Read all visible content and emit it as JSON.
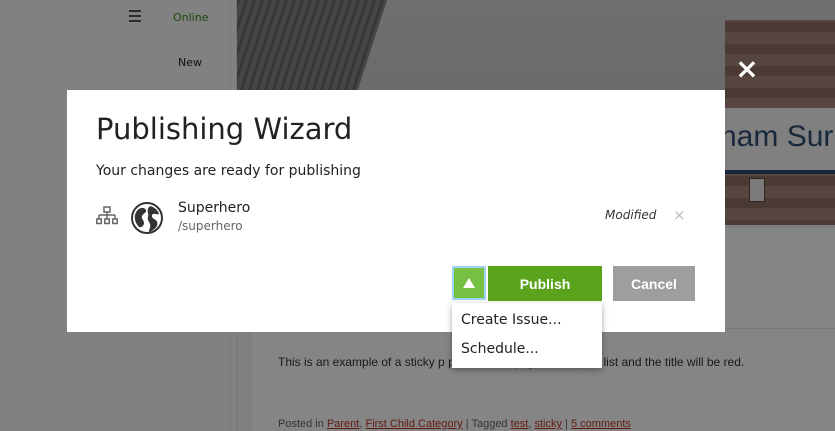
{
  "background": {
    "sidebar": {
      "status": "Online",
      "new_label": "New"
    },
    "site_title": "ham Sur",
    "post": {
      "text": "This is an example of a sticky p                                          p of the first page of the post list and the title will be red.",
      "meta": {
        "posted_in": "Posted in",
        "cat1": "Parent",
        "sep1": ",",
        "cat2": "First Child Category",
        "tagged": "| Tagged",
        "tag1": "test",
        "sep2": ",",
        "tag2": "sticky",
        "sep3": "|",
        "comments": "5 comments"
      }
    }
  },
  "modal": {
    "close_glyph": "×",
    "title": "Publishing Wizard",
    "subtitle": "Your changes are ready for publishing",
    "item": {
      "icon_tree": "sitemap-icon",
      "icon_globe": "globe-icon",
      "name": "Superhero",
      "path": "/superhero",
      "status": "Modified",
      "remove_glyph": "×"
    },
    "buttons": {
      "publish": "Publish",
      "cancel": "Cancel"
    },
    "dropdown": {
      "options": [
        "Create Issue...",
        "Schedule..."
      ]
    }
  },
  "colors": {
    "publish_green": "#5ba31c",
    "toggle_green": "#76c043",
    "cancel_gray": "#9e9e9e",
    "online_green": "#3b8a1c",
    "link_red": "#c0392b",
    "site_title_blue": "#2e4f73"
  }
}
